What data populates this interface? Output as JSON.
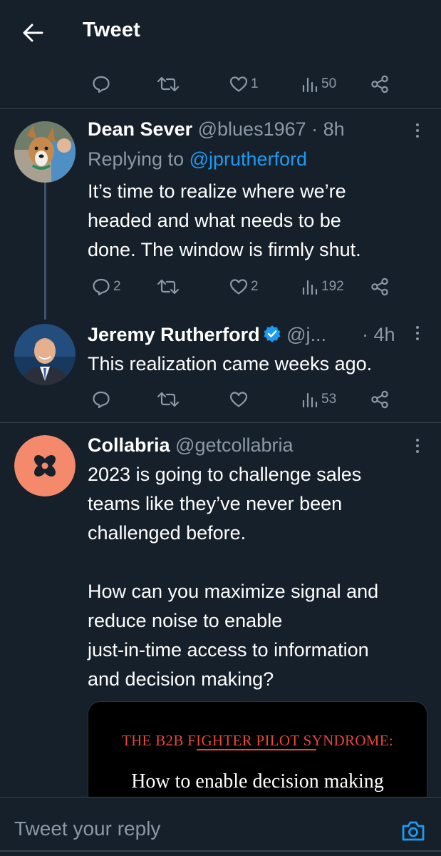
{
  "header": {
    "title": "Tweet"
  },
  "top_actions": {
    "replies": "",
    "retweets": "",
    "likes": "1",
    "views": "50"
  },
  "tweets": [
    {
      "name": "Dean Sever",
      "handle": "@blues1967",
      "time": "· 8h",
      "replying_prefix": "Replying to ",
      "replying_to": "@jprutherford",
      "text": "It’s time to realize where we’re\nheaded and what needs to be\ndone. The window is firmly shut.",
      "replies": "2",
      "retweets": "",
      "likes": "2",
      "views": "192"
    },
    {
      "name": "Jeremy Rutherford",
      "handle": "@j...",
      "time": "· 4h",
      "text": "This realization came weeks ago.",
      "replies": "",
      "retweets": "",
      "likes": "",
      "views": "53"
    },
    {
      "name": "Collabria",
      "handle": "@getcollabria",
      "text": "2023 is going to challenge sales\nteams like they’ve never been\nchallenged before.\n\nHow can you maximize signal and\nreduce noise to enable\njust-in-time access to information\nand decision making?",
      "media": {
        "title": "THE B2B FIGHTER PILOT SYNDROME:",
        "subtitle": "How to enable decision making"
      }
    }
  ],
  "composer": {
    "placeholder": "Tweet your reply"
  },
  "colors": {
    "background": "#15202b",
    "muted": "#8b98a5",
    "accent": "#1d9bf0",
    "collabria_brand": "#f4896b"
  }
}
